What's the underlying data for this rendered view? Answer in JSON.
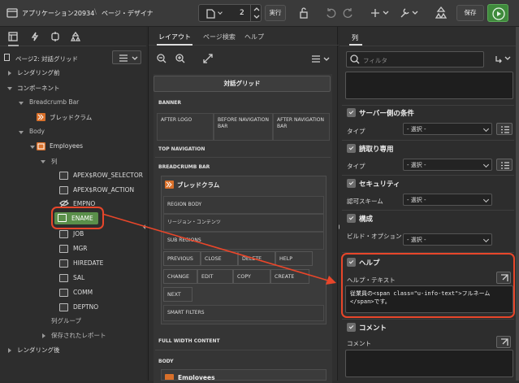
{
  "app": {
    "title": "アプリケーション20934",
    "separator": "\\",
    "page_title": "ページ・デザイナ",
    "page_number": "2",
    "run_label": "実行",
    "save_label": "保存"
  },
  "left": {
    "page_node": "ページ2: 対話グリッド",
    "tree": [
      {
        "label": "レンダリング前"
      },
      {
        "label": "コンポーネント"
      },
      {
        "label": "Breadcrumb Bar"
      },
      {
        "label": "ブレッドクラム"
      },
      {
        "label": "Body"
      },
      {
        "label": "Employees"
      },
      {
        "label": "列"
      },
      {
        "label": "APEX$ROW_SELECTOR"
      },
      {
        "label": "APEX$ROW_ACTION"
      },
      {
        "label": "EMPNO"
      },
      {
        "label": "ENAME"
      },
      {
        "label": "JOB"
      },
      {
        "label": "MGR"
      },
      {
        "label": "HIREDATE"
      },
      {
        "label": "SAL"
      },
      {
        "label": "COMM"
      },
      {
        "label": "DEPTNO"
      },
      {
        "label": "列グループ"
      },
      {
        "label": "保存されたレポート"
      },
      {
        "label": "レンダリング後"
      }
    ]
  },
  "mid": {
    "tabs": [
      "レイアウト",
      "ページ検索",
      "ヘルプ"
    ],
    "page_title": "対話グリッド",
    "sections": {
      "banner": "BANNER",
      "after_logo": "AFTER LOGO",
      "before_nav": "BEFORE NAVIGATION BAR",
      "after_nav": "AFTER NAVIGATION BAR",
      "top_nav": "TOP NAVIGATION",
      "breadcrumb_bar": "BREADCRUMB BAR",
      "full_width": "FULL WIDTH CONTENT",
      "body": "BODY"
    },
    "breadcrumb_region": "ブレッドクラム",
    "region_body": "REGION BODY",
    "region_content": "リージョン・コンテンツ",
    "sub_regions": "SUB REGIONS",
    "buttons": [
      "PREVIOUS",
      "CLOSE",
      "DELETE",
      "HELP",
      "CHANGE",
      "EDIT",
      "COPY",
      "CREATE",
      "NEXT"
    ],
    "smart_filters": "SMART FILTERS",
    "body_region": "Employees"
  },
  "right": {
    "tab": "列",
    "filter_placeholder": "フィルタ",
    "groups": {
      "server": "サーバー側の条件",
      "readonly": "読取り専用",
      "security": "セキュリティ",
      "config": "構成",
      "help": "ヘルプ",
      "comment": "コメント"
    },
    "labels": {
      "type1": "タイプ",
      "type2": "タイプ",
      "auth": "認可スキーム",
      "build": "ビルド・オプション",
      "help_text": "ヘルプ・テキスト",
      "comment": "コメント"
    },
    "select_value": "- 選択 -",
    "help_value_1": "従業員の<span class=\"u-info-text\">フルネーム",
    "help_value_2": "</span>です。"
  },
  "colors": {
    "accent_red": "#e8462a",
    "run_green": "#3f8a3c",
    "ename_green": "#5a8f4a"
  }
}
